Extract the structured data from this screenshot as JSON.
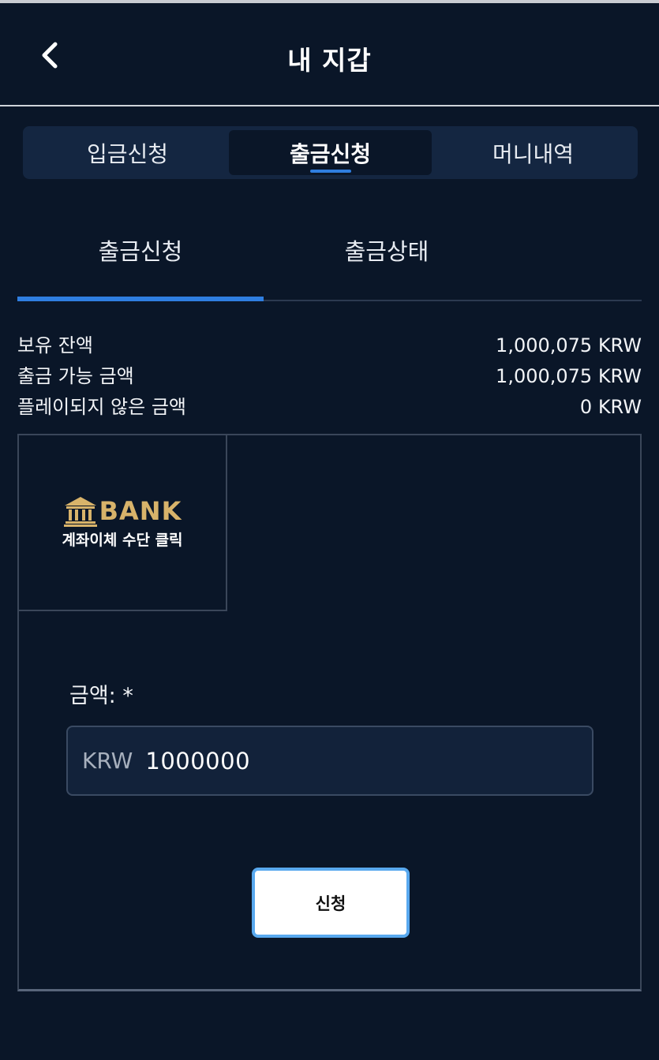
{
  "header": {
    "title": "내 지갑",
    "back_icon": "chevron-left-icon"
  },
  "main_tabs": [
    {
      "label": "입금신청",
      "active": false
    },
    {
      "label": "출금신청",
      "active": true
    },
    {
      "label": "머니내역",
      "active": false
    }
  ],
  "sub_tabs": [
    {
      "label": "출금신청",
      "active": true
    },
    {
      "label": "출금상태",
      "active": false
    }
  ],
  "balances": [
    {
      "label": "보유 잔액",
      "value": "1,000,075 KRW"
    },
    {
      "label": "출금 가능 금액",
      "value": "1,000,075 KRW"
    },
    {
      "label": "플레이되지 않은 금액",
      "value": "0 KRW"
    }
  ],
  "bank_method": {
    "logo_text": "BANK",
    "caption": "계좌이체 수단 클릭",
    "icon": "bank-building-icon"
  },
  "form": {
    "amount_label": "금액: *",
    "currency": "KRW",
    "amount_value": "1000000",
    "submit_label": "신청"
  },
  "colors": {
    "background": "#0a1628",
    "accent": "#2f7ee0",
    "bank_gold": "#d8b36a",
    "button_border": "#59a9ef"
  }
}
